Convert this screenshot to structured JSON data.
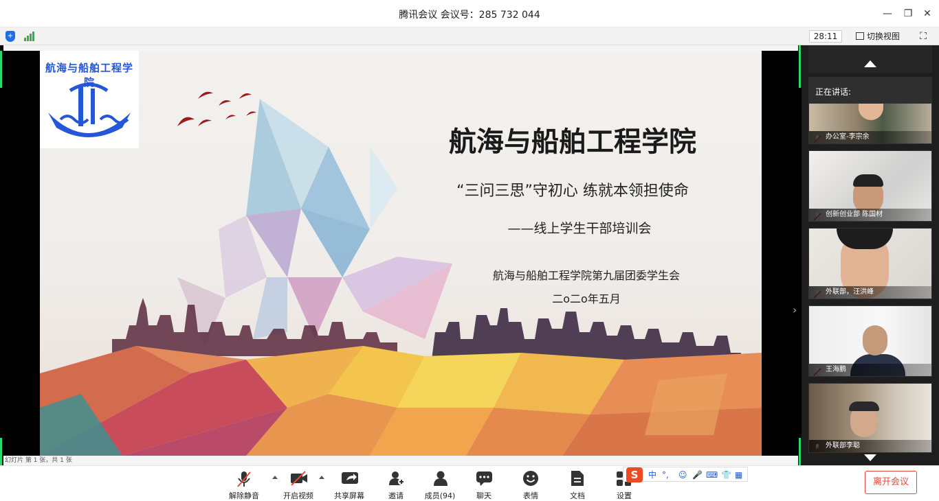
{
  "window": {
    "title": "腾讯会议 会议号：285 732 044"
  },
  "infobar": {
    "timer": "28:11",
    "switch_view_label": "切换视图"
  },
  "slide": {
    "heading": "航海与船舶工程学院",
    "subtitle": "“三问三思”守初心 练就本领担使命",
    "sub2": "——线上学生干部培训会",
    "org": "航海与船舶工程学院第九届团委学生会",
    "date": "二o二o年五月",
    "logo_text": "航海与船舶工程学院",
    "status": "幻灯片 第 1 张，共 1 张"
  },
  "sidebar": {
    "speaking_label": "正在讲话:",
    "participants": [
      {
        "name": "办公室-李宗余"
      },
      {
        "name": "创新创业部 陈国材"
      },
      {
        "name": "外联部，汪洪峰"
      },
      {
        "name": "王海鹏"
      },
      {
        "name": "外联部李聪"
      }
    ]
  },
  "toolbar": {
    "unmute": "解除静音",
    "start_video": "开启视频",
    "share": "共享屏幕",
    "invite": "邀请",
    "members": "成员(94)",
    "chat": "聊天",
    "emoji": "表情",
    "docs": "文档",
    "settings": "设置",
    "leave": "离开会议"
  },
  "ime": {
    "logo": "S",
    "mode": "中",
    "punct": "°,"
  }
}
